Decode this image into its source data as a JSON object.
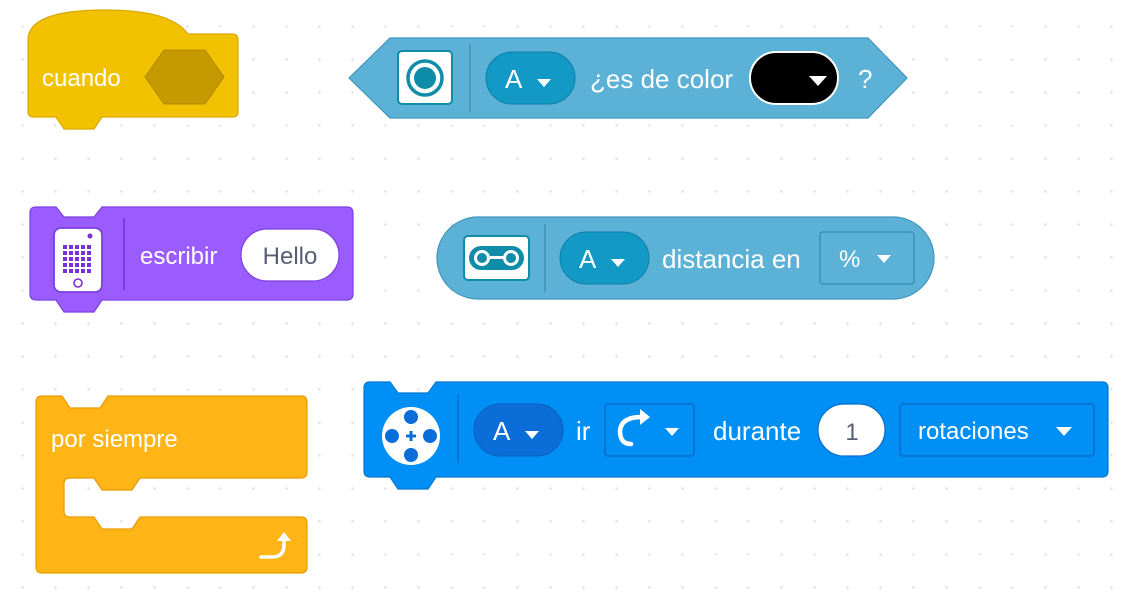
{
  "blocks": {
    "when": {
      "label": "cuando"
    },
    "color_sensor": {
      "port": "A",
      "text": "¿es de color",
      "question_mark": "?",
      "color_value": "#000000"
    },
    "display_write": {
      "label": "escribir",
      "input_value": "Hello"
    },
    "distance_sensor": {
      "port": "A",
      "text": "distancia en",
      "unit": "%"
    },
    "forever": {
      "label": "por siempre"
    },
    "motor_run": {
      "port": "A",
      "go_label": "ir",
      "during_label": "durante",
      "amount": "1",
      "unit": "rotaciones"
    }
  },
  "colors": {
    "events_yellow": "#f2c200",
    "sensor_cyan": "#5cb1d6",
    "display_purple": "#9a5cff",
    "control_orange": "#ffb515",
    "motor_blue": "#0090f5"
  }
}
